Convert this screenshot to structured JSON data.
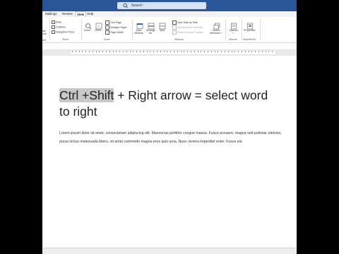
{
  "search": {
    "placeholder": "Search"
  },
  "tabs": [
    {
      "label": "Mailings",
      "active": false
    },
    {
      "label": "Review",
      "active": false
    },
    {
      "label": "View",
      "active": true
    },
    {
      "label": "Help",
      "active": false
    }
  ],
  "ribbon": {
    "show": {
      "label": "Show",
      "ruler": "Ruler",
      "gridlines": "Gridlines",
      "navigation_pane": "Navigation Pane",
      "left_fragments": [
        "ide",
        "ook",
        "ext"
      ]
    },
    "zoom": {
      "label": "Zoom",
      "zoom_button": "Zoom",
      "percent_button": "100%",
      "one_page": "One Page",
      "multiple_pages": "Multiple Pages",
      "page_width": "Page Width"
    },
    "window": {
      "label": "Window",
      "new_window": [
        "New",
        "Window"
      ],
      "arrange_all": [
        "Arrange",
        "All"
      ],
      "split": "Split",
      "view_side_by_side": "View Side by Side",
      "synchronous_scrolling": "Synchronous Scrolling",
      "reset_window_position": "Reset Window Position",
      "switch_windows": [
        "Switch",
        "Windows ˅"
      ]
    },
    "macros": {
      "label": "Macros",
      "button": [
        "Macros",
        "˅"
      ]
    },
    "sharepoint": {
      "label": "SharePoint",
      "button": "Properties"
    }
  },
  "document": {
    "heading_selected": "Ctrl +Shift",
    "heading_rest": "+ Right arrow = select word to right",
    "body": "Lorem ipsum dolor sit amet, consectetuer adipiscing elit. Maecenas porttitor congue massa. Fusce posuere, magna sed pulvinar ultricies, purus lectus malesuada libero, sit amet commodo magna eros quis urna. Nunc viverra imperdiet enim. Fusce est."
  },
  "colors": {
    "title_bar": "#2b579a",
    "selection": "#c8c8c8",
    "accent": "#2b579a"
  }
}
